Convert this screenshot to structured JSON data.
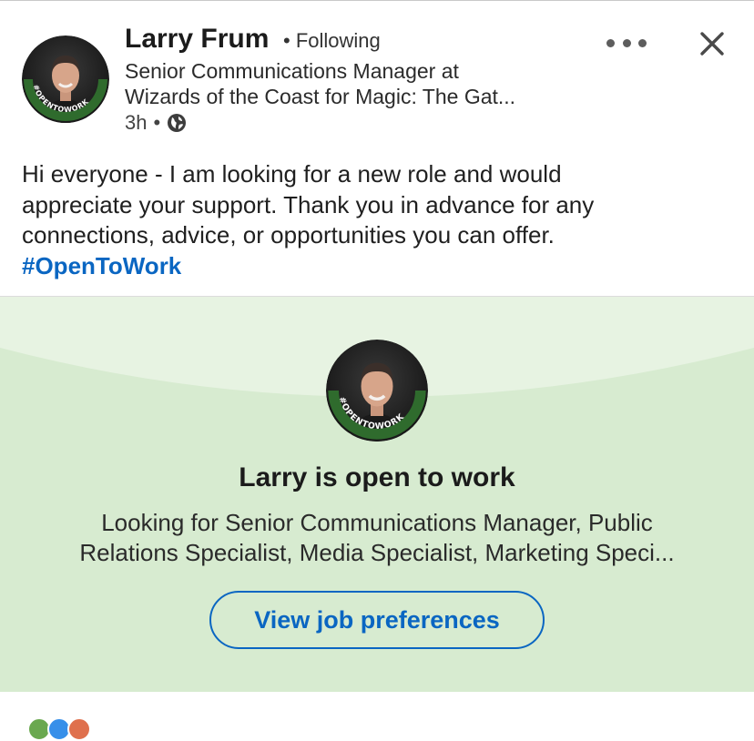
{
  "post": {
    "author_name": "Larry Frum",
    "following": "• Following",
    "headline_line1": "Senior Communications Manager at",
    "headline_line2": "Wizards of the Coast for Magic: The Gat...",
    "time": "3h",
    "visibility_icon": "globe-icon",
    "text_lines": [
      "Hi everyone - I am looking for a new role and would",
      "appreciate your support. Thank you in advance for any",
      "connections, advice, or opportunities you can offer."
    ],
    "hashtag": "#OpenToWork",
    "frame_badge": "#OPENTOWORK"
  },
  "actions": {
    "more_icon": "more-horizontal-icon",
    "close_icon": "close-icon"
  },
  "open_to_work": {
    "title": "Larry is open to work",
    "desc_line1": "Looking for Senior Communications Manager, Public",
    "desc_line2": "Relations Specialist, Media Specialist, Marketing Speci...",
    "button_label": "View job preferences"
  },
  "colors": {
    "accent": "#0a66c2",
    "card_bg": "#d7ebd0",
    "card_arc": "#e7f3e2",
    "otw_frame": "#2f6b2d"
  }
}
